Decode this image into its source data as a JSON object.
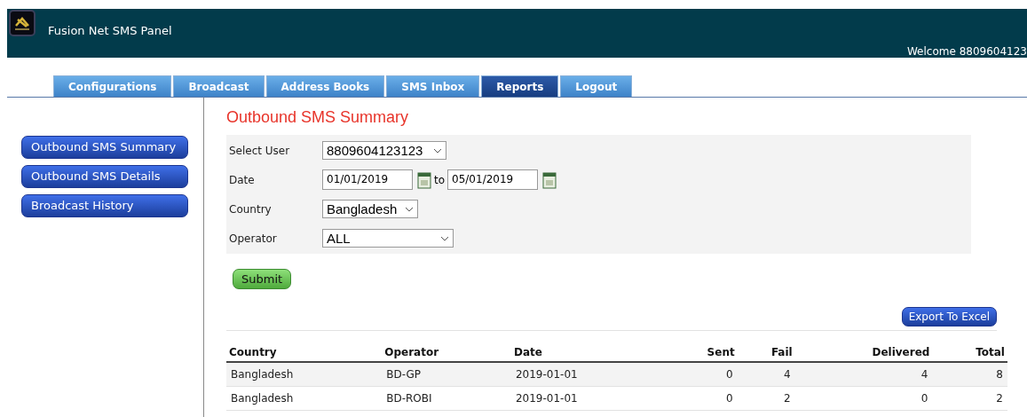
{
  "header": {
    "title": "Fusion Net SMS Panel",
    "welcome": "Welcome 8809604123"
  },
  "tabs": [
    {
      "label": "Configurations",
      "selected": false
    },
    {
      "label": "Broadcast",
      "selected": false
    },
    {
      "label": "Address Books",
      "selected": false
    },
    {
      "label": "SMS Inbox",
      "selected": false
    },
    {
      "label": "Reports",
      "selected": true
    },
    {
      "label": "Logout",
      "selected": false
    }
  ],
  "sidebar": {
    "items": [
      {
        "label": "Outbound SMS Summary"
      },
      {
        "label": "Outbound SMS Details"
      },
      {
        "label": "Broadcast History"
      }
    ]
  },
  "page_title": "Outbound SMS Summary",
  "form": {
    "select_user": {
      "label": "Select User",
      "value": "8809604123123"
    },
    "date": {
      "label": "Date",
      "from": "01/01/2019",
      "separator": "to",
      "to": "05/01/2019"
    },
    "country": {
      "label": "Country",
      "value": "Bangladesh"
    },
    "operator": {
      "label": "Operator",
      "value": "ALL"
    },
    "submit": "Submit"
  },
  "export_button": "Export To Excel",
  "table": {
    "columns": [
      "Country",
      "Operator",
      "Date",
      "Sent",
      "Fail",
      "Delivered",
      "Total"
    ],
    "rows": [
      [
        "Bangladesh",
        "BD-GP",
        "2019-01-01",
        "0",
        "4",
        "4",
        "8"
      ],
      [
        "Bangladesh",
        "BD-ROBI",
        "2019-01-01",
        "0",
        "2",
        "0",
        "2"
      ]
    ]
  }
}
